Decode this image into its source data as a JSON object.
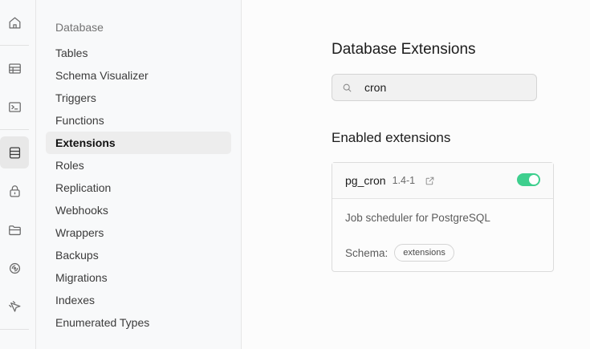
{
  "rail": {
    "items": [
      {
        "icon": "home-icon"
      },
      {
        "icon": "table-editor-icon"
      },
      {
        "icon": "sql-editor-icon"
      },
      {
        "icon": "database-icon",
        "active": true
      },
      {
        "icon": "auth-lock-icon"
      },
      {
        "icon": "storage-folder-icon"
      },
      {
        "icon": "realtime-icon"
      },
      {
        "icon": "edge-functions-icon"
      }
    ]
  },
  "menu": {
    "heading": "Database",
    "items": [
      {
        "label": "Tables"
      },
      {
        "label": "Schema Visualizer"
      },
      {
        "label": "Triggers"
      },
      {
        "label": "Functions"
      },
      {
        "label": "Extensions",
        "active": true
      },
      {
        "label": "Roles"
      },
      {
        "label": "Replication"
      },
      {
        "label": "Webhooks"
      },
      {
        "label": "Wrappers"
      },
      {
        "label": "Backups"
      },
      {
        "label": "Migrations"
      },
      {
        "label": "Indexes"
      },
      {
        "label": "Enumerated Types"
      }
    ]
  },
  "main": {
    "title": "Database Extensions",
    "search": {
      "value": "cron",
      "icon": "search-icon"
    },
    "section_title": "Enabled extensions",
    "extension": {
      "name": "pg_cron",
      "version": "1.4-1",
      "enabled": true,
      "description": "Job scheduler for PostgreSQL",
      "schema_label": "Schema:",
      "schema_value": "extensions"
    }
  },
  "colors": {
    "accent_green": "#3ecf8e",
    "background": "#f8f9fa"
  }
}
